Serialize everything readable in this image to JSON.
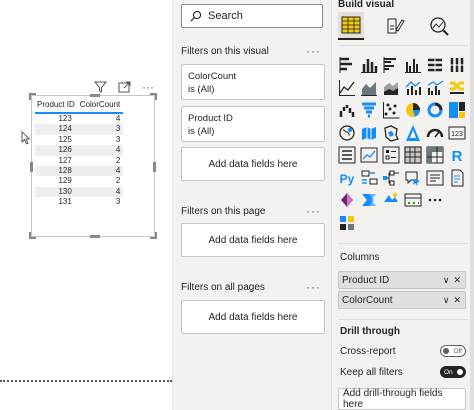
{
  "canvas": {
    "table": {
      "headers": [
        "Product ID",
        "ColorCount"
      ],
      "rows": [
        [
          "123",
          "4"
        ],
        [
          "124",
          "3"
        ],
        [
          "125",
          "3"
        ],
        [
          "126",
          "4"
        ],
        [
          "127",
          "2"
        ],
        [
          "128",
          "4"
        ],
        [
          "129",
          "2"
        ],
        [
          "130",
          "4"
        ],
        [
          "131",
          "3"
        ]
      ]
    },
    "header_icons": [
      "filter-icon",
      "focus-mode-icon",
      "more-options-icon"
    ],
    "more_glyph": "···"
  },
  "filters": {
    "search_placeholder": "Search",
    "on_visual": {
      "title": "Filters on this visual",
      "cards": [
        {
          "field": "ColorCount",
          "state": "is (All)"
        },
        {
          "field": "Product ID",
          "state": "is (All)"
        }
      ],
      "add": "Add data fields here"
    },
    "on_page": {
      "title": "Filters on this page",
      "add": "Add data fields here"
    },
    "on_all_pages": {
      "title": "Filters on all pages",
      "add": "Add data fields here"
    },
    "more_glyph": "···"
  },
  "build": {
    "title": "Build visual",
    "tabs": [
      "build-visual-icon",
      "format-visual-icon",
      "analytics-icon"
    ],
    "columns_label": "Columns",
    "wells": [
      "Product ID",
      "ColorCount"
    ],
    "drill": {
      "title": "Drill through",
      "cross_report_label": "Cross-report",
      "cross_report_state": "Off",
      "keep_filters_label": "Keep all filters",
      "keep_filters_state": "On",
      "add_label": "Add drill-through fields here"
    },
    "viz_icons": [
      "stacked-bar-icon",
      "stacked-column-icon",
      "clustered-bar-icon",
      "clustered-column-icon",
      "100-stacked-bar-icon",
      "100-stacked-column-icon",
      "line-chart-icon",
      "area-chart-icon",
      "stacked-area-icon",
      "line-column-icon",
      "line-clustered-column-icon",
      "ribbon-chart-icon",
      "waterfall-icon",
      "funnel-icon",
      "scatter-icon",
      "pie-icon",
      "donut-icon",
      "treemap-icon",
      "map-icon",
      "filled-map-icon",
      "shape-map-icon",
      "azure-map-icon",
      "gauge-icon",
      "card-icon",
      "multi-row-card-icon",
      "kpi-icon",
      "slicer-icon",
      "table-icon",
      "matrix-icon",
      "r-visual-icon",
      "python-visual-icon",
      "key-influencers-icon",
      "decomposition-tree-icon",
      "qa-icon",
      "narrative-icon",
      "paginated-report-icon",
      "power-apps-icon",
      "power-automate-icon",
      "arcgis-icon",
      "metrics-icon",
      "more-visuals-icon",
      "",
      "custom-visual-icon"
    ],
    "selected_viz": "table-icon",
    "accent": "#118dff"
  }
}
